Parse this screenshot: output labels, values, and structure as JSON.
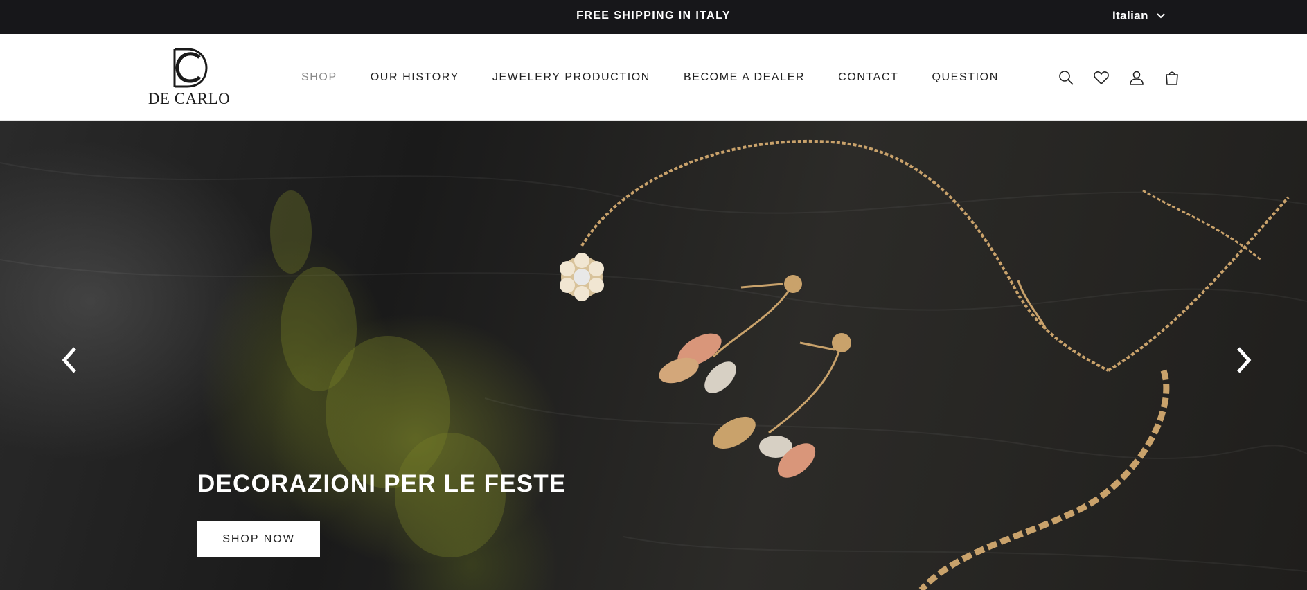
{
  "announcement": {
    "text": "FREE SHIPPING IN ITALY"
  },
  "language": {
    "selected": "Italian",
    "icon": "chevron-down-icon"
  },
  "logo": {
    "text": "DE CARLO",
    "monogram": "DC"
  },
  "nav": {
    "items": [
      {
        "label": "SHOP",
        "active": true
      },
      {
        "label": "OUR HISTORY"
      },
      {
        "label": "JEWELERY PRODUCTION"
      },
      {
        "label": "BECOME A DEALER"
      },
      {
        "label": "CONTACT"
      },
      {
        "label": "QUESTION"
      }
    ]
  },
  "header_icons": [
    "search-icon",
    "heart-icon",
    "account-icon",
    "cart-icon"
  ],
  "hero": {
    "title": "DECORAZIONI PER LE FESTE",
    "cta_label": "SHOP NOW",
    "prev_icon": "chevron-left-icon",
    "next_icon": "chevron-right-icon"
  },
  "colors": {
    "topbar_bg": "#17171a",
    "nav_active": "#8a8a8a",
    "text": "#222222",
    "gold": "#c9a26b",
    "rose_gold": "#d9967a"
  }
}
